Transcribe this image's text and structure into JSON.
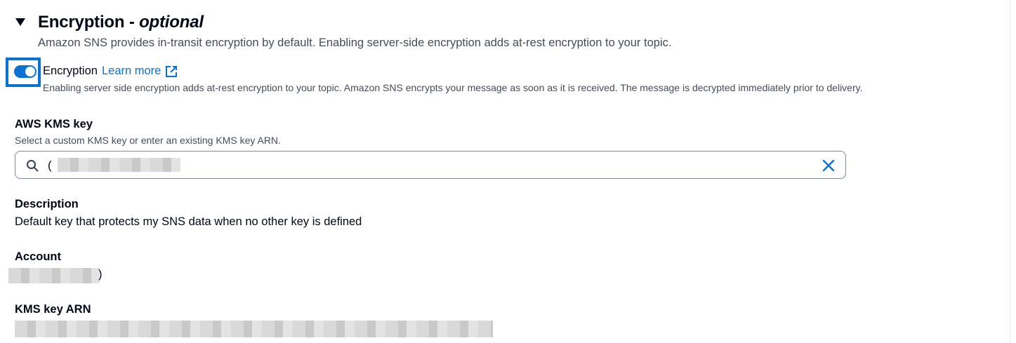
{
  "section": {
    "title": "Encryption",
    "separator": " - ",
    "title_suffix": "optional",
    "description": "Amazon SNS provides in-transit encryption by default. Enabling server-side encryption adds at-rest encryption to your topic."
  },
  "encryption_toggle": {
    "label": "Encryption",
    "enabled": true,
    "learn_more": "Learn more",
    "description": "Enabling server side encryption adds at-rest encryption to your topic. Amazon SNS encrypts your message as soon as it is received. The message is decrypted immediately prior to delivery."
  },
  "kms_key": {
    "label": "AWS KMS key",
    "hint": "Select a custom KMS key or enter an existing KMS key ARN.",
    "value": "("
  },
  "description_field": {
    "label": "Description",
    "value": "Default key that protects my SNS data when no other key is defined"
  },
  "account_field": {
    "label": "Account",
    "value": ")"
  },
  "arn_field": {
    "label": "KMS key ARN"
  },
  "colors": {
    "accent": "#0972d3",
    "text": "#000716",
    "secondary_text": "#414d5c",
    "border": "#7d8998"
  },
  "icons": {
    "caret": "caret-down-icon",
    "external": "external-link-icon",
    "search": "search-icon",
    "clear": "close-icon"
  }
}
